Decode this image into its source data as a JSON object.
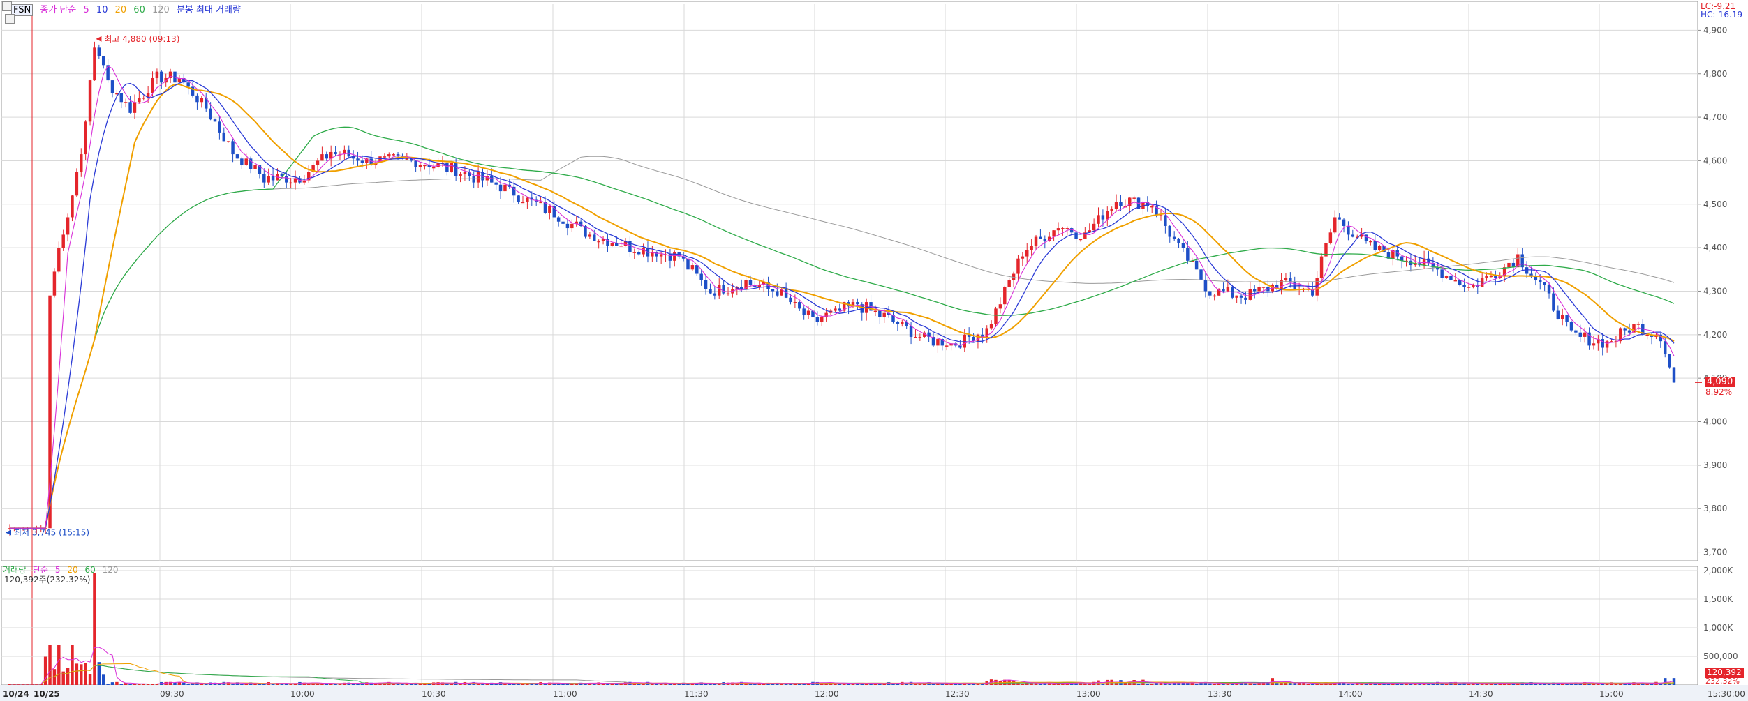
{
  "header": {
    "symbol": "FSN",
    "price_legend_prefix": "종가 단순",
    "ma_periods": [
      "5",
      "10",
      "20",
      "60",
      "120"
    ],
    "extra_label": "분봉 최대 거래량",
    "lc_label": "LC:-9.21",
    "hc_label": "HC:-16.19"
  },
  "colors": {
    "up": "#e4252b",
    "down": "#1e4fc7",
    "ma5": "#d82fd8",
    "ma10": "#2b3bd6",
    "ma20": "#f0a000",
    "ma60": "#2eab49",
    "ma120": "#9a9a9a",
    "grid": "#d9d9d9",
    "axis_text": "#555555"
  },
  "annotations": {
    "high_label": "최고 4,880 (09:13)",
    "low_label": "최저 3,745 (15:15)",
    "current_price": "4,090",
    "current_change": "8.92%"
  },
  "volume_panel": {
    "legend_name": "거래량",
    "legend_prefix": "단순",
    "ma_periods": [
      "5",
      "20",
      "60",
      "120"
    ],
    "current_volume": "120,392주(232.32%)",
    "current_box": "120,392",
    "current_box_pct": "232.32%",
    "y_ticks": [
      "2,000K",
      "1,500K",
      "1,000K",
      "500,000"
    ]
  },
  "chart_data": {
    "type": "candlestick",
    "price_axis": {
      "ticks": [
        "4,900",
        "4,800",
        "4,700",
        "4,600",
        "4,500",
        "4,400",
        "4,300",
        "4,200",
        "4,100",
        "4,000",
        "3,900",
        "3,800",
        "3,700"
      ],
      "ylim": [
        3680,
        4960
      ]
    },
    "time_axis": {
      "ticks": [
        "10/24",
        "10/25",
        "09:30",
        "10:00",
        "10:30",
        "11:00",
        "11:30",
        "12:00",
        "12:30",
        "13:00",
        "13:30",
        "14:00",
        "14:30",
        "15:00",
        "15:30:00"
      ]
    },
    "high": {
      "price": 4880,
      "time": "09:13"
    },
    "low": {
      "price": 3745,
      "time": "15:15"
    },
    "last_price": 4090,
    "keypoints": [
      [
        0,
        3755
      ],
      [
        8,
        3755
      ],
      [
        9,
        4290
      ],
      [
        11,
        4400
      ],
      [
        14,
        4520
      ],
      [
        17,
        4680
      ],
      [
        19,
        4880
      ],
      [
        22,
        4780
      ],
      [
        27,
        4720
      ],
      [
        33,
        4790
      ],
      [
        38,
        4790
      ],
      [
        44,
        4720
      ],
      [
        50,
        4620
      ],
      [
        57,
        4560
      ],
      [
        65,
        4560
      ],
      [
        72,
        4620
      ],
      [
        80,
        4600
      ],
      [
        90,
        4600
      ],
      [
        100,
        4580
      ],
      [
        110,
        4540
      ],
      [
        120,
        4490
      ],
      [
        130,
        4430
      ],
      [
        140,
        4400
      ],
      [
        150,
        4380
      ],
      [
        157,
        4300
      ],
      [
        165,
        4320
      ],
      [
        172,
        4300
      ],
      [
        180,
        4230
      ],
      [
        190,
        4270
      ],
      [
        198,
        4230
      ],
      [
        205,
        4190
      ],
      [
        212,
        4180
      ],
      [
        219,
        4210
      ],
      [
        227,
        4390
      ],
      [
        235,
        4450
      ],
      [
        241,
        4430
      ],
      [
        248,
        4510
      ],
      [
        256,
        4500
      ],
      [
        262,
        4400
      ],
      [
        269,
        4300
      ],
      [
        277,
        4290
      ],
      [
        285,
        4320
      ],
      [
        292,
        4300
      ],
      [
        297,
        4470
      ],
      [
        305,
        4400
      ],
      [
        312,
        4380
      ],
      [
        320,
        4350
      ],
      [
        327,
        4310
      ],
      [
        333,
        4340
      ],
      [
        338,
        4380
      ],
      [
        344,
        4300
      ],
      [
        350,
        4200
      ],
      [
        358,
        4180
      ],
      [
        364,
        4220
      ],
      [
        370,
        4200
      ],
      [
        373,
        4090
      ]
    ],
    "bar_count": 374,
    "volume_axis": {
      "ticks": [
        "2,000K",
        "1,500K",
        "1,000K",
        "500,000"
      ],
      "ylim": [
        0,
        2000000
      ]
    }
  }
}
